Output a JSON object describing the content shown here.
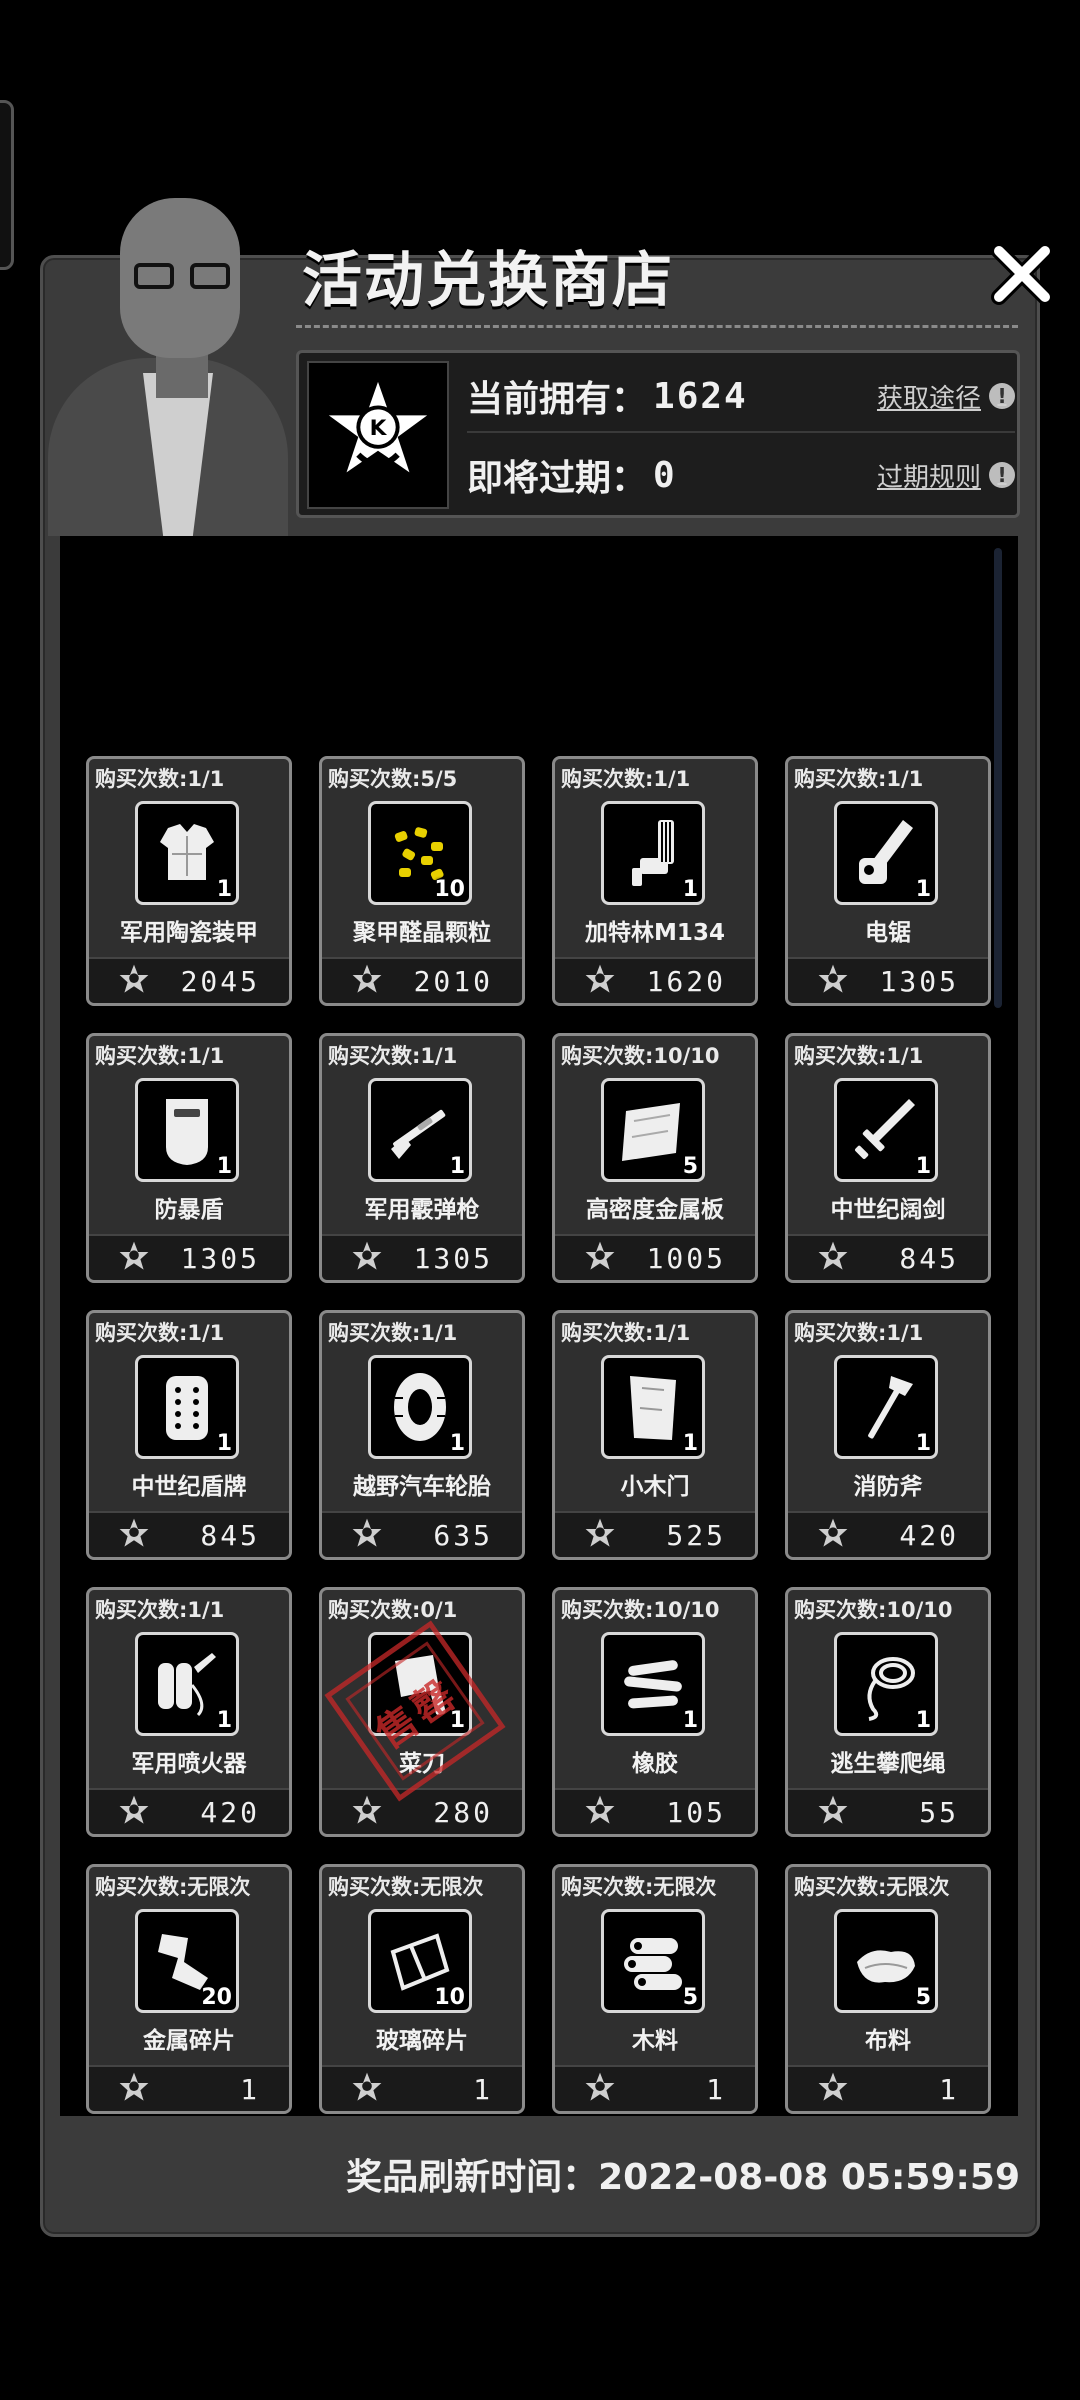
{
  "title": "活动兑换商店",
  "currency": {
    "owned_label": "当前拥有：",
    "owned_value": "1624",
    "owned_link": "获取途径",
    "expiring_label": "即将过期：",
    "expiring_value": "0",
    "expiring_link": "过期规则",
    "emblem_letter": "K"
  },
  "items": [
    {
      "limit": "购买次数:1/1",
      "name": "军用陶瓷装甲",
      "qty": "1",
      "price": "2045",
      "icon": "armor-icon"
    },
    {
      "limit": "购买次数:5/5",
      "name": "聚甲醛晶颗粒",
      "qty": "10",
      "price": "2010",
      "icon": "pellets-icon"
    },
    {
      "limit": "购买次数:1/1",
      "name": "加特林M134",
      "qty": "1",
      "price": "1620",
      "icon": "gatling-icon"
    },
    {
      "limit": "购买次数:1/1",
      "name": "电锯",
      "qty": "1",
      "price": "1305",
      "icon": "chainsaw-icon"
    },
    {
      "limit": "购买次数:1/1",
      "name": "防暴盾",
      "qty": "1",
      "price": "1305",
      "icon": "riot-shield-icon"
    },
    {
      "limit": "购买次数:1/1",
      "name": "军用霰弹枪",
      "qty": "1",
      "price": "1305",
      "icon": "shotgun-icon"
    },
    {
      "limit": "购买次数:10/10",
      "name": "高密度金属板",
      "qty": "5",
      "price": "1005",
      "icon": "metal-plate-icon"
    },
    {
      "limit": "购买次数:1/1",
      "name": "中世纪阔剑",
      "qty": "1",
      "price": "845",
      "icon": "broadsword-icon"
    },
    {
      "limit": "购买次数:1/1",
      "name": "中世纪盾牌",
      "qty": "1",
      "price": "845",
      "icon": "medieval-shield-icon"
    },
    {
      "limit": "购买次数:1/1",
      "name": "越野汽车轮胎",
      "qty": "1",
      "price": "635",
      "icon": "tire-icon"
    },
    {
      "limit": "购买次数:1/1",
      "name": "小木门",
      "qty": "1",
      "price": "525",
      "icon": "wooden-door-icon"
    },
    {
      "limit": "购买次数:1/1",
      "name": "消防斧",
      "qty": "1",
      "price": "420",
      "icon": "fire-axe-icon"
    },
    {
      "limit": "购买次数:1/1",
      "name": "军用喷火器",
      "qty": "1",
      "price": "420",
      "icon": "flamethrower-icon"
    },
    {
      "limit": "购买次数:0/1",
      "name": "菜刀",
      "qty": "1",
      "price": "280",
      "icon": "cleaver-icon",
      "sold_out": true,
      "stamp_text": "售罄"
    },
    {
      "limit": "购买次数:10/10",
      "name": "橡胶",
      "qty": "1",
      "price": "105",
      "icon": "rubber-icon"
    },
    {
      "limit": "购买次数:10/10",
      "name": "逃生攀爬绳",
      "qty": "1",
      "price": "55",
      "icon": "rope-icon"
    },
    {
      "limit": "购买次数:无限次",
      "name": "金属碎片",
      "qty": "20",
      "price": "1",
      "icon": "metal-scrap-icon"
    },
    {
      "limit": "购买次数:无限次",
      "name": "玻璃碎片",
      "qty": "10",
      "price": "1",
      "icon": "glass-shard-icon"
    },
    {
      "limit": "购买次数:无限次",
      "name": "木料",
      "qty": "5",
      "price": "1",
      "icon": "wood-logs-icon"
    },
    {
      "limit": "购买次数:无限次",
      "name": "布料",
      "qty": "5",
      "price": "1",
      "icon": "cloth-icon"
    }
  ],
  "refresh_text": "奖品刷新时间：2022-08-08 05:59:59",
  "colors": {
    "panel": "#3b3b3b",
    "card": "#2f2f2f",
    "stamp": "#c82828"
  }
}
